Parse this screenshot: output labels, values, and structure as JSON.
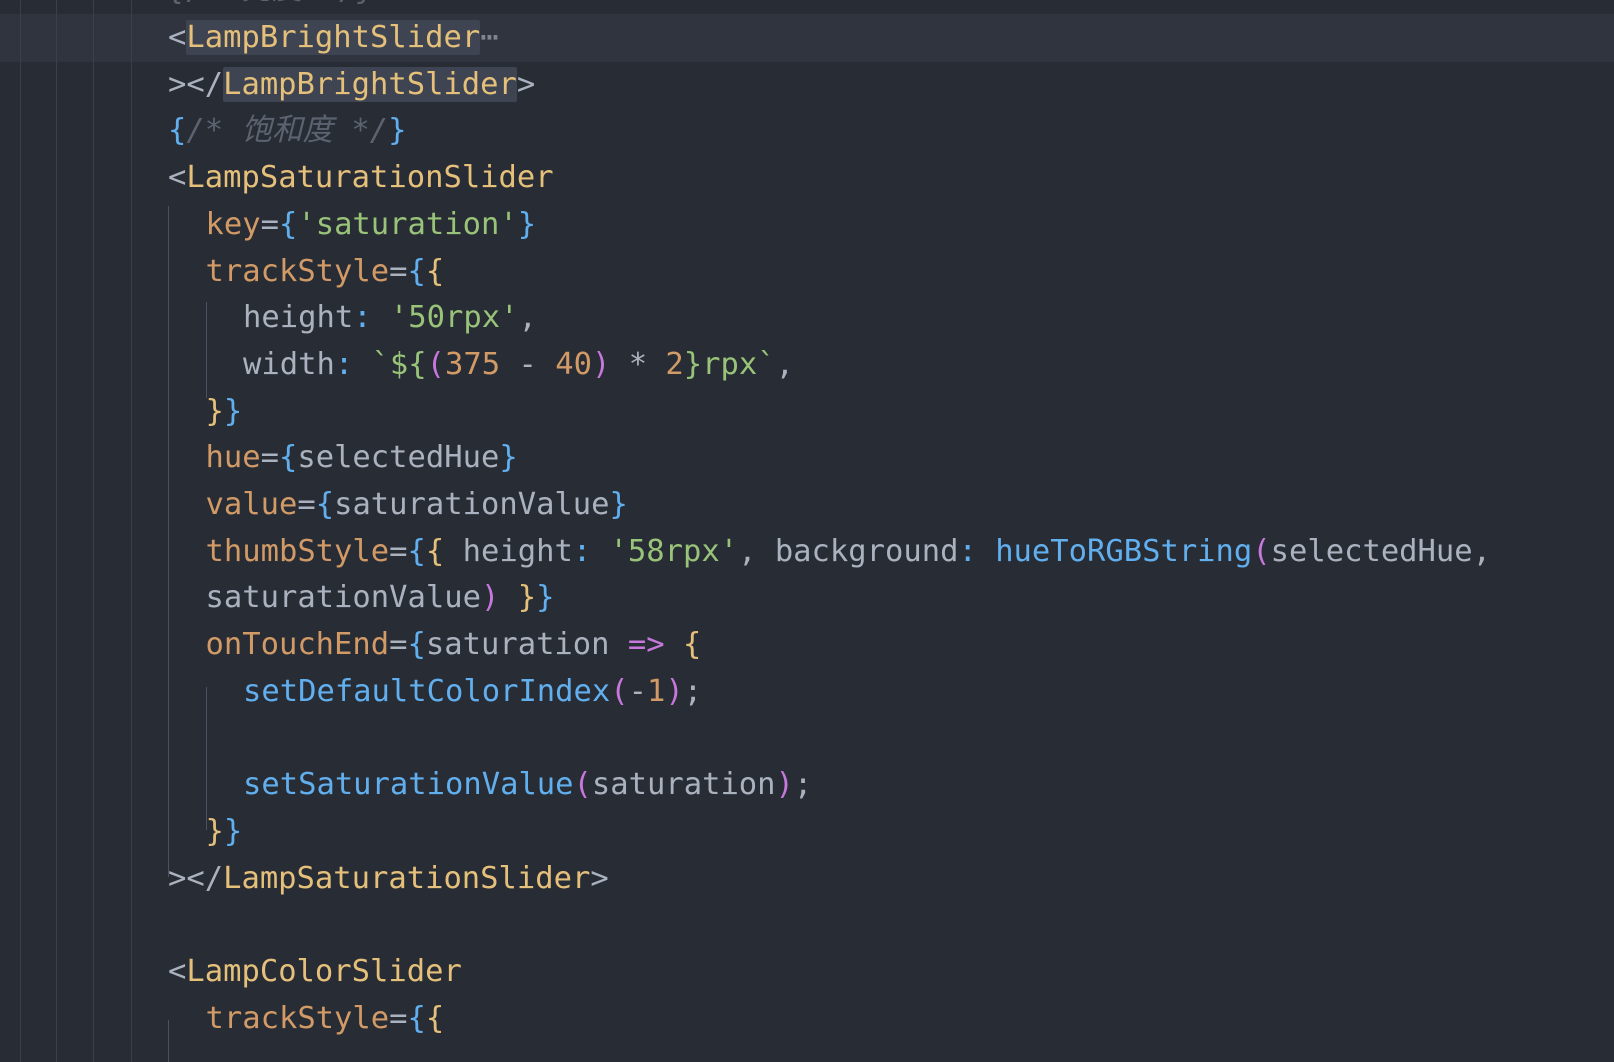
{
  "editor": {
    "theme_colors": {
      "background": "#282c34",
      "tag": "#e5c07b",
      "attribute": "#d19a66",
      "string": "#98c379",
      "function": "#61afef",
      "keyword": "#c678dd",
      "comment": "#5c6370"
    },
    "top_partial_text": "{/* 亮度 */}",
    "lines": [
      {
        "indent": 4,
        "tokens": [
          {
            "t": "<",
            "c": "punct"
          },
          {
            "t": "LampBrightSlider",
            "c": "tag match"
          },
          {
            "t": "⋯",
            "c": "fold"
          }
        ]
      },
      {
        "indent": 4,
        "tokens": [
          {
            "t": "></",
            "c": "punct"
          },
          {
            "t": "LampBrightSlider",
            "c": "tag match"
          },
          {
            "t": ">",
            "c": "punct"
          }
        ]
      },
      {
        "indent": 4,
        "tokens": [
          {
            "t": "{",
            "c": "brace"
          },
          {
            "t": "/* 饱和度 */",
            "c": "cmt"
          },
          {
            "t": "}",
            "c": "brace"
          }
        ]
      },
      {
        "indent": 4,
        "tokens": [
          {
            "t": "<",
            "c": "punct"
          },
          {
            "t": "LampSaturationSlider",
            "c": "tag"
          }
        ]
      },
      {
        "indent": 5,
        "tokens": [
          {
            "t": "key",
            "c": "attr"
          },
          {
            "t": "=",
            "c": "punct"
          },
          {
            "t": "{",
            "c": "brace"
          },
          {
            "t": "'saturation'",
            "c": "str"
          },
          {
            "t": "}",
            "c": "brace"
          }
        ]
      },
      {
        "indent": 5,
        "tokens": [
          {
            "t": "trackStyle",
            "c": "attr"
          },
          {
            "t": "=",
            "c": "punct"
          },
          {
            "t": "{",
            "c": "brace"
          },
          {
            "t": "{",
            "c": "brace2"
          }
        ]
      },
      {
        "indent": 6,
        "tokens": [
          {
            "t": "height",
            "c": "prop"
          },
          {
            "t": ": ",
            "c": "fn"
          },
          {
            "t": "'50rpx'",
            "c": "str"
          },
          {
            "t": ",",
            "c": "punct"
          }
        ]
      },
      {
        "indent": 6,
        "tokens": [
          {
            "t": "width",
            "c": "prop"
          },
          {
            "t": ": ",
            "c": "fn"
          },
          {
            "t": "`${",
            "c": "str"
          },
          {
            "t": "(",
            "c": "paren"
          },
          {
            "t": "375",
            "c": "num"
          },
          {
            "t": " - ",
            "c": "punct"
          },
          {
            "t": "40",
            "c": "num"
          },
          {
            "t": ")",
            "c": "paren"
          },
          {
            "t": " * ",
            "c": "punct"
          },
          {
            "t": "2",
            "c": "num"
          },
          {
            "t": "}rpx`",
            "c": "str"
          },
          {
            "t": ",",
            "c": "punct"
          }
        ]
      },
      {
        "indent": 5,
        "tokens": [
          {
            "t": "}",
            "c": "brace2"
          },
          {
            "t": "}",
            "c": "brace"
          }
        ]
      },
      {
        "indent": 5,
        "tokens": [
          {
            "t": "hue",
            "c": "attr"
          },
          {
            "t": "=",
            "c": "punct"
          },
          {
            "t": "{",
            "c": "brace"
          },
          {
            "t": "selectedHue",
            "c": "var"
          },
          {
            "t": "}",
            "c": "brace"
          }
        ]
      },
      {
        "indent": 5,
        "tokens": [
          {
            "t": "value",
            "c": "attr"
          },
          {
            "t": "=",
            "c": "punct"
          },
          {
            "t": "{",
            "c": "brace"
          },
          {
            "t": "saturationValue",
            "c": "var"
          },
          {
            "t": "}",
            "c": "brace"
          }
        ]
      },
      {
        "indent": 5,
        "tokens": [
          {
            "t": "thumbStyle",
            "c": "attr"
          },
          {
            "t": "=",
            "c": "punct"
          },
          {
            "t": "{",
            "c": "brace"
          },
          {
            "t": "{",
            "c": "brace2"
          },
          {
            "t": " height",
            "c": "prop"
          },
          {
            "t": ": ",
            "c": "fn"
          },
          {
            "t": "'58rpx'",
            "c": "str"
          },
          {
            "t": ", background",
            "c": "prop"
          },
          {
            "t": ": ",
            "c": "fn"
          },
          {
            "t": "hueToRGBString",
            "c": "fn"
          },
          {
            "t": "(",
            "c": "paren"
          },
          {
            "t": "selectedHue,",
            "c": "var"
          }
        ]
      },
      {
        "indent": 5,
        "tokens": [
          {
            "t": "saturationValue",
            "c": "var"
          },
          {
            "t": ")",
            "c": "paren"
          },
          {
            "t": " ",
            "c": "punct"
          },
          {
            "t": "}",
            "c": "brace2"
          },
          {
            "t": "}",
            "c": "brace"
          }
        ]
      },
      {
        "indent": 5,
        "tokens": [
          {
            "t": "onTouchEnd",
            "c": "attr"
          },
          {
            "t": "=",
            "c": "punct"
          },
          {
            "t": "{",
            "c": "brace"
          },
          {
            "t": "saturation ",
            "c": "var"
          },
          {
            "t": "=>",
            "c": "kw"
          },
          {
            "t": " ",
            "c": "punct"
          },
          {
            "t": "{",
            "c": "brace2"
          }
        ]
      },
      {
        "indent": 6,
        "tokens": [
          {
            "t": "setDefaultColorIndex",
            "c": "fn"
          },
          {
            "t": "(",
            "c": "paren"
          },
          {
            "t": "-",
            "c": "punct"
          },
          {
            "t": "1",
            "c": "num"
          },
          {
            "t": ")",
            "c": "paren"
          },
          {
            "t": ";",
            "c": "punct"
          }
        ]
      },
      {
        "indent": 6,
        "tokens": []
      },
      {
        "indent": 6,
        "tokens": [
          {
            "t": "setSaturationValue",
            "c": "fn"
          },
          {
            "t": "(",
            "c": "paren"
          },
          {
            "t": "saturation",
            "c": "var"
          },
          {
            "t": ")",
            "c": "paren"
          },
          {
            "t": ";",
            "c": "punct"
          }
        ]
      },
      {
        "indent": 5,
        "tokens": [
          {
            "t": "}",
            "c": "brace2"
          },
          {
            "t": "}",
            "c": "brace"
          }
        ]
      },
      {
        "indent": 4,
        "tokens": [
          {
            "t": "></",
            "c": "punct"
          },
          {
            "t": "LampSaturationSlider",
            "c": "tag"
          },
          {
            "t": ">",
            "c": "punct"
          }
        ]
      },
      {
        "indent": 4,
        "tokens": []
      },
      {
        "indent": 4,
        "tokens": [
          {
            "t": "<",
            "c": "punct"
          },
          {
            "t": "LampColorSlider",
            "c": "tag"
          }
        ]
      },
      {
        "indent": 5,
        "tokens": [
          {
            "t": "trackStyle",
            "c": "attr"
          },
          {
            "t": "=",
            "c": "punct"
          },
          {
            "t": "{",
            "c": "brace"
          },
          {
            "t": "{",
            "c": "brace2"
          }
        ]
      }
    ]
  }
}
